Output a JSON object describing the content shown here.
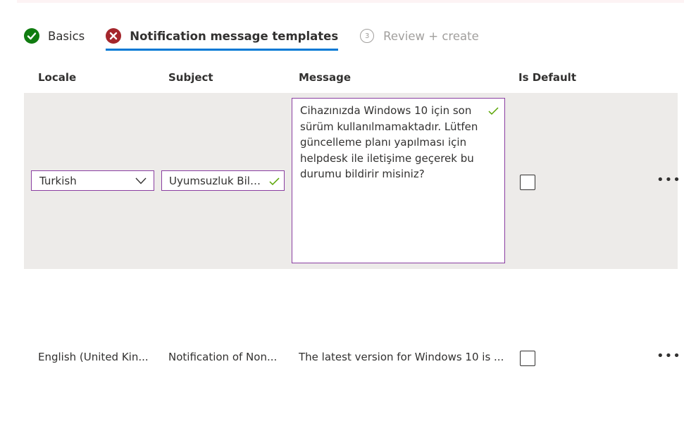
{
  "steps": [
    {
      "label": "Basics",
      "state": "complete"
    },
    {
      "label": "Notification message templates",
      "state": "error"
    },
    {
      "label": "Review + create",
      "number": "3",
      "state": "disabled"
    }
  ],
  "columns": {
    "locale": "Locale",
    "subject": "Subject",
    "message": "Message",
    "is_default": "Is Default"
  },
  "rows": [
    {
      "locale": "Turkish",
      "subject": "Uyumsuzluk Bildirimi",
      "message": "Cihazınızda Windows 10 için son sürüm kullanılmamaktadır. Lütfen güncelleme planı yapılması için helpdesk ile iletişime geçerek bu durumu bildirir misiniz?",
      "is_default": false
    },
    {
      "locale": "English (United Kin...",
      "subject": "Notification of Non...",
      "message": "The latest version for Windows 10 is ...",
      "is_default": false
    }
  ],
  "more_glyph": "•••",
  "colors": {
    "accent": "#0078d4",
    "success": "#107c10",
    "error": "#a4262c",
    "input_border": "#8a3ea1",
    "selected_row": "#edebe9"
  }
}
